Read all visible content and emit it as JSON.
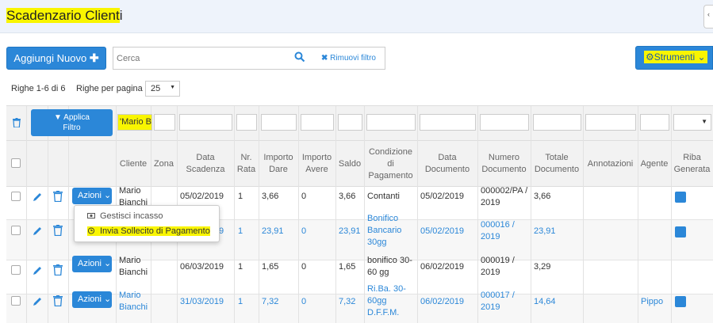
{
  "title": {
    "highlighted": "Scadenzario Client",
    "rest": "i"
  },
  "toolbar": {
    "add_label": "Aggiungi Nuovo",
    "search_placeholder": "Cerca",
    "remove_filter_label": "Rimuovi filtro",
    "tools_label": "Strumenti"
  },
  "pagination": {
    "rows_info": "Righe 1-6 di 6",
    "rows_per_page_label": "Righe per pagina",
    "rows_per_page_value": "25"
  },
  "filters": {
    "apply_label_1": "Applica",
    "apply_label_2": "Filtro",
    "cliente_value": "'Mario B"
  },
  "columns": {
    "cliente": "Cliente",
    "zona": "Zona",
    "data_scadenza": [
      "Data",
      "Scadenza"
    ],
    "nr_rata": [
      "Nr.",
      "Rata"
    ],
    "importo_dare": [
      "Importo",
      "Dare"
    ],
    "importo_avere": [
      "Importo",
      "Avere"
    ],
    "saldo": "Saldo",
    "condizione": [
      "Condizione",
      "di",
      "Pagamento"
    ],
    "data_documento": [
      "Data",
      "Documento"
    ],
    "numero_documento": [
      "Numero",
      "Documento"
    ],
    "totale_documento": [
      "Totale",
      "Documento"
    ],
    "annotazioni": "Annotazioni",
    "agente": "Agente",
    "riba": [
      "Riba",
      "Generata"
    ]
  },
  "actions_label": "Azioni",
  "rows": [
    {
      "cliente": [
        "Mario",
        "Bianchi"
      ],
      "scadenza": "05/02/2019",
      "rata": "1",
      "dare": "3,66",
      "avere": "0",
      "saldo": "3,66",
      "condizione": [
        "Contanti"
      ],
      "data_doc": "05/02/2019",
      "num_doc": [
        "000002/PA /",
        "2019"
      ],
      "totale": "3,66",
      "agente": ""
    },
    {
      "cliente": [
        "",
        ""
      ],
      "scadenza": "9",
      "rata": "1",
      "dare": "23,91",
      "avere": "0",
      "saldo": "23,91",
      "condizione": [
        "Bonifico",
        "Bancario",
        "30gg"
      ],
      "data_doc": "05/02/2019",
      "num_doc": [
        "000016 /",
        "2019"
      ],
      "totale": "23,91",
      "agente": ""
    },
    {
      "cliente": [
        "Mario",
        "Bianchi"
      ],
      "scadenza": "06/03/2019",
      "rata": "1",
      "dare": "1,65",
      "avere": "0",
      "saldo": "1,65",
      "condizione": [
        "bonifico 30-",
        "60 gg"
      ],
      "data_doc": "06/02/2019",
      "num_doc": [
        "000019 /",
        "2019"
      ],
      "totale": "3,29",
      "agente": ""
    },
    {
      "cliente": [
        "Mario",
        "Bianchi"
      ],
      "scadenza": "31/03/2019",
      "rata": "1",
      "dare": "7,32",
      "avere": "0",
      "saldo": "7,32",
      "condizione": [
        "Ri.Ba. 30-",
        "60gg",
        "D.F.F.M."
      ],
      "data_doc": "06/02/2019",
      "num_doc": [
        "000017 /",
        "2019"
      ],
      "totale": "14,64",
      "agente": "Pippo"
    }
  ],
  "dropdown": {
    "item1": "Gestisci incasso",
    "item2": "Invia Sollecito di Pagamento"
  },
  "colors": {
    "primary": "#2b87d8",
    "highlight": "#f9f500"
  }
}
